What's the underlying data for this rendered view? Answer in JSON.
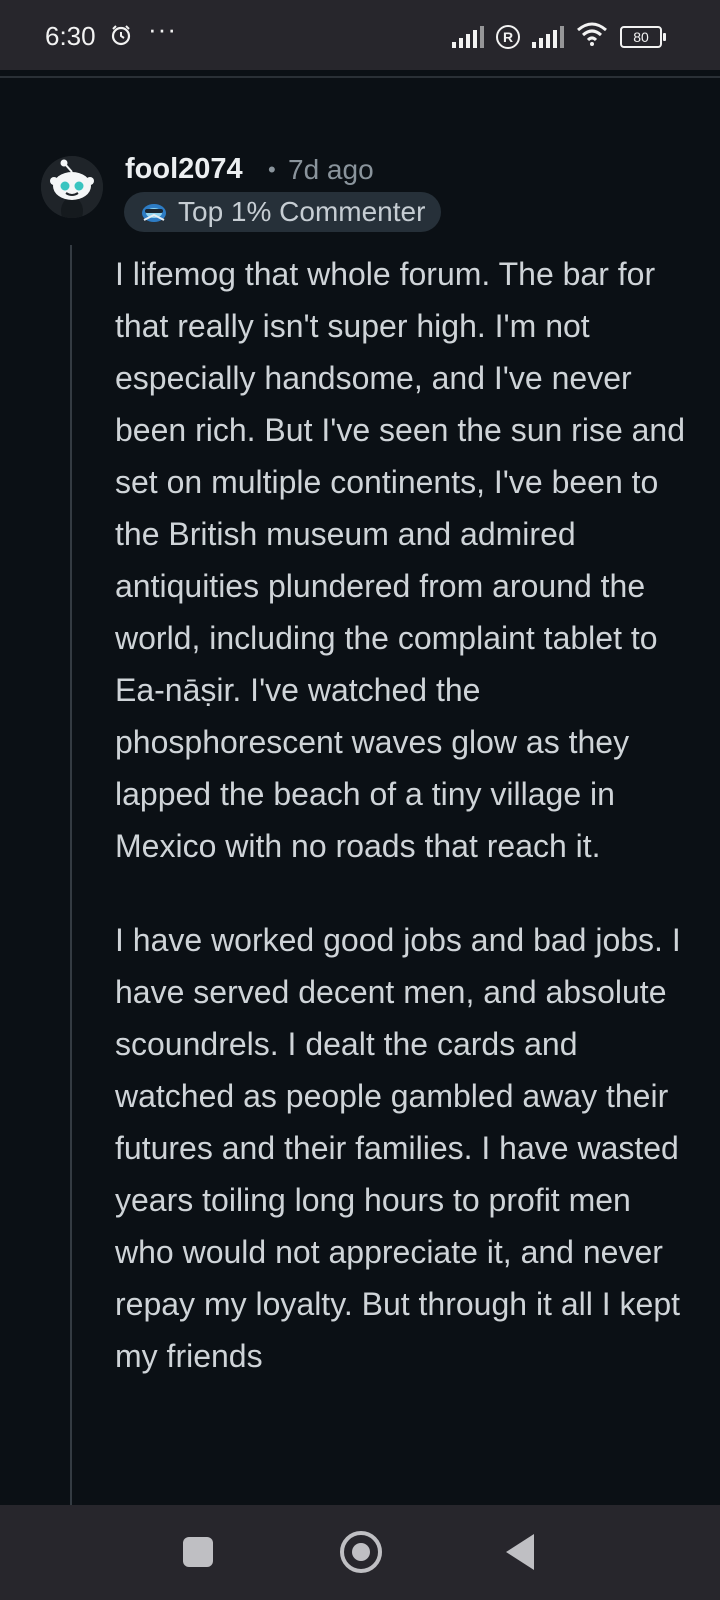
{
  "status_bar": {
    "time": "6:30",
    "alarm_icon": "alarm-icon",
    "more": "···",
    "battery": "80"
  },
  "comment": {
    "avatar_icon": "snoo-avatar-icon",
    "username": "fool2074",
    "separator": "•",
    "time_ago": "7d ago",
    "flair": "Top 1% Commenter",
    "paragraphs": [
      "I lifemog that whole forum. The bar for that really isn't super high. I'm not especially handsome, and I've never been rich. But I've seen the sun rise and set on multiple continents, I've been to the British museum and admired antiquities plundered from around the world, including the complaint tablet to Ea-nāṣir. I've watched the phosphorescent waves glow as they lapped the beach of a tiny village in Mexico with no roads that reach it.",
      "I have worked good jobs and bad jobs. I have served decent men, and absolute scoundrels. I dealt the cards and watched as people gambled away their futures and their families. I have wasted years toiling long hours to profit men who would not appreciate it, and never repay my loyalty. But through it all I kept my friends"
    ]
  },
  "nav": {
    "recents_icon": "recents-icon",
    "home_icon": "home-icon",
    "back_icon": "back-icon"
  },
  "colors": {
    "background": "#0b1015",
    "text": "#cfd4d8",
    "muted": "#8a949c",
    "flair_bg": "#263039",
    "system_bar": "#27262c"
  }
}
